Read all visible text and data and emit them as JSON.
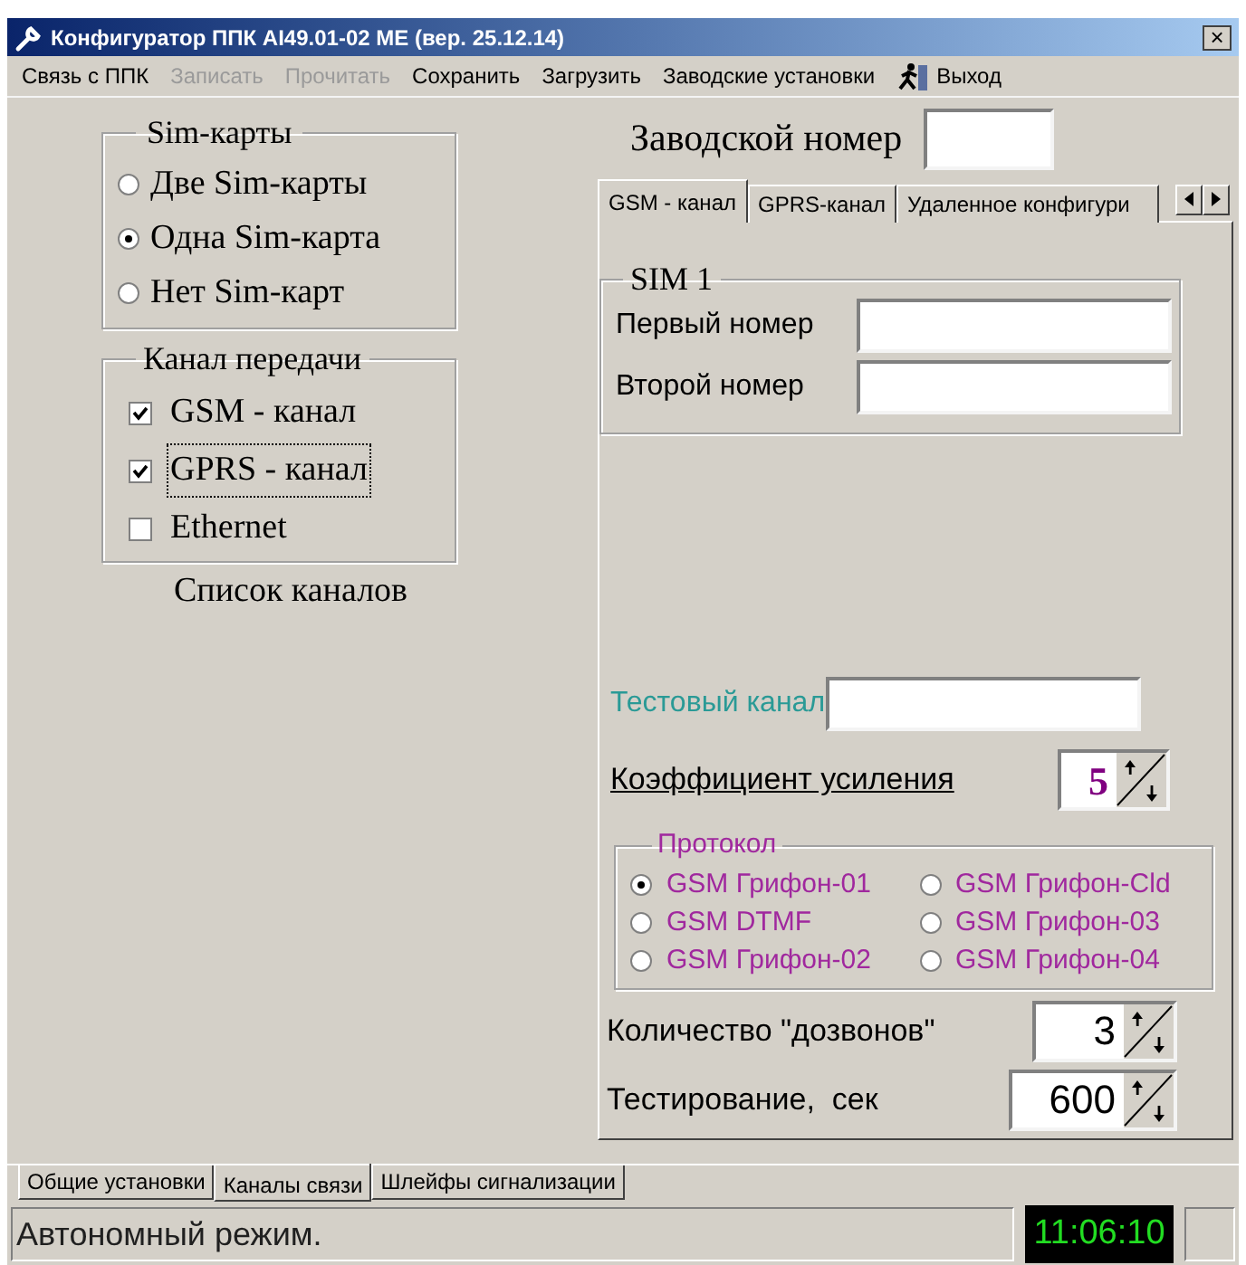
{
  "window": {
    "title": "Конфигуратор ППК АІ49.01-02 МЕ (вер. 25.12.14)",
    "close": "×"
  },
  "menu": [
    {
      "label": "Связь с ППК",
      "disabled": false
    },
    {
      "label": "Записать",
      "disabled": true
    },
    {
      "label": "Прочитать",
      "disabled": true
    },
    {
      "label": "Сохранить",
      "disabled": false
    },
    {
      "label": "Загрузить",
      "disabled": false
    },
    {
      "label": "Заводские установки",
      "disabled": false
    },
    {
      "label": "Выход",
      "disabled": false,
      "kind": "exit"
    }
  ],
  "sim_cards": {
    "title": "Sim-карты",
    "options": [
      {
        "label": "Две Sim-карты",
        "selected": false
      },
      {
        "label": "Одна Sim-карта",
        "selected": true
      },
      {
        "label": "Нет Sim-карт",
        "selected": false
      }
    ]
  },
  "transfer_channel": {
    "title": "Канал передачи",
    "items": [
      {
        "label": "GSM - канал",
        "checked": true,
        "focused": false
      },
      {
        "label": "GPRS - канал",
        "checked": true,
        "focused": true
      },
      {
        "label": "Ethernet",
        "checked": false,
        "focused": false
      }
    ]
  },
  "channel_list_label": "Список каналов",
  "serial_number": {
    "label": "Заводской номер"
  },
  "tabs": [
    {
      "label": "GSM - канал",
      "selected": true
    },
    {
      "label": "GPRS-канал",
      "selected": false
    },
    {
      "label": "Удаленное конфигури",
      "selected": false
    }
  ],
  "sim1": {
    "title": "SIM 1",
    "fields": [
      {
        "label": "Первый номер"
      },
      {
        "label": "Второй номер"
      }
    ]
  },
  "test_channel": {
    "label": "Тестовый канал"
  },
  "gain": {
    "label": "Коэффициент усиления",
    "value": "5"
  },
  "protocol": {
    "title": "Протокол",
    "options": [
      {
        "label": "GSM Грифон-01",
        "selected": true
      },
      {
        "label": "GSM Грифон-Cld",
        "selected": false
      },
      {
        "label": "GSM DTMF",
        "selected": false
      },
      {
        "label": "GSM Грифон-03",
        "selected": false
      },
      {
        "label": "GSM Грифон-02",
        "selected": false
      },
      {
        "label": "GSM Грифон-04",
        "selected": false
      }
    ]
  },
  "redials": {
    "label": "Количество \"дозвонов\"",
    "value": "3"
  },
  "testing": {
    "label": "Тестирование,  сек",
    "value": "600"
  },
  "bottom_tabs": [
    {
      "label": "Общие установки",
      "selected": false
    },
    {
      "label": "Каналы связи",
      "selected": true
    },
    {
      "label": "Шлейфы сигнализации",
      "selected": false
    }
  ],
  "status_bar": {
    "message": "Автономный режим.",
    "clock": "11:06:10"
  }
}
